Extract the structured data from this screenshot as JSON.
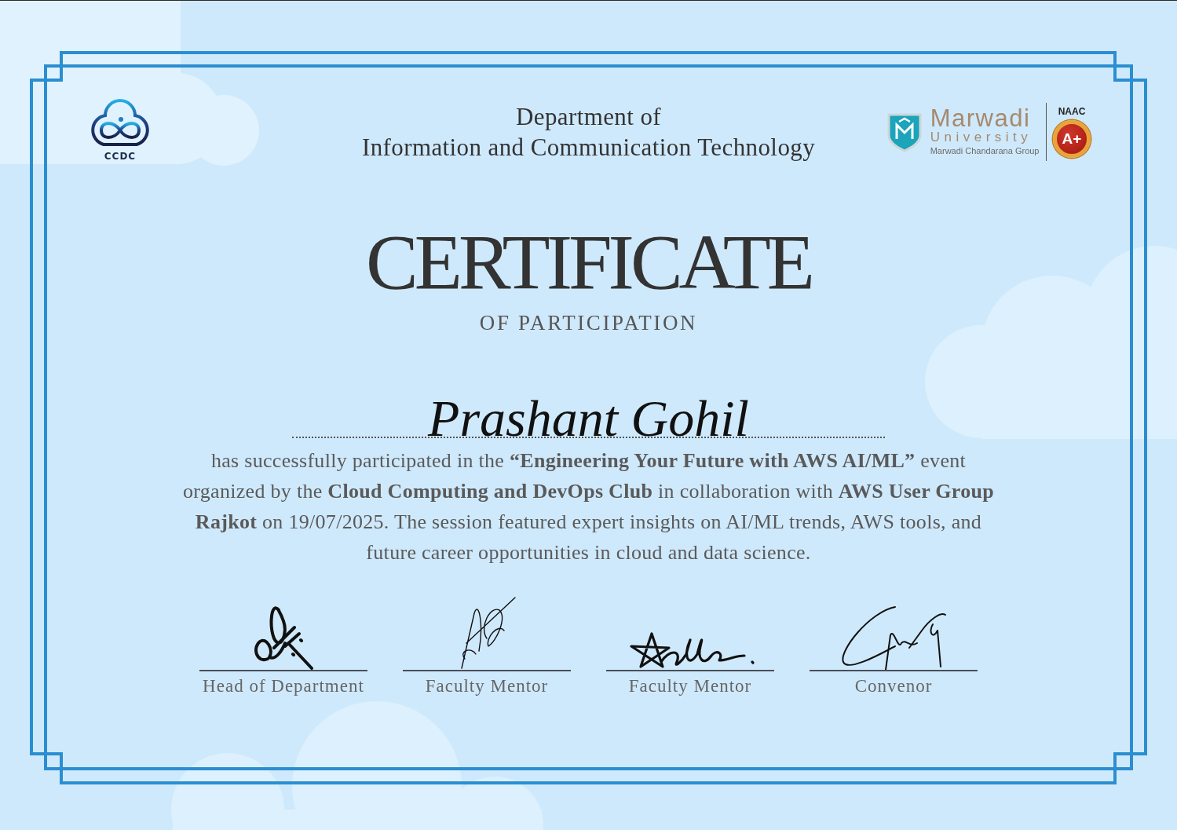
{
  "header": {
    "club_logo": {
      "label": "CCDC"
    },
    "department": [
      "Department of",
      "Information and Communication Technology"
    ],
    "university_logo": {
      "name": "Marwadi",
      "subtitle": "University",
      "group": "Marwadi Chandarana Group",
      "accreditation": "NAAC",
      "grade": "A+"
    }
  },
  "certificate": {
    "title": "CERTIFICATE",
    "subtitle": "OF PARTICIPATION",
    "recipient": "Prashant Gohil",
    "body": "has successfully participated in the **“Engineering Your Future with AWS AI/ML”** event organized by the **Cloud Computing and DevOps Club** in collaboration with **AWS User Group Rajkot** on 19/07/2025. The session featured expert insights on AI/ML trends, AWS tools, and future career opportunities in cloud and data science."
  },
  "signatures": [
    {
      "title": "Head of Department"
    },
    {
      "title": "Faculty Mentor"
    },
    {
      "title": "Faculty Mentor"
    },
    {
      "title": "Convenor"
    }
  ]
}
